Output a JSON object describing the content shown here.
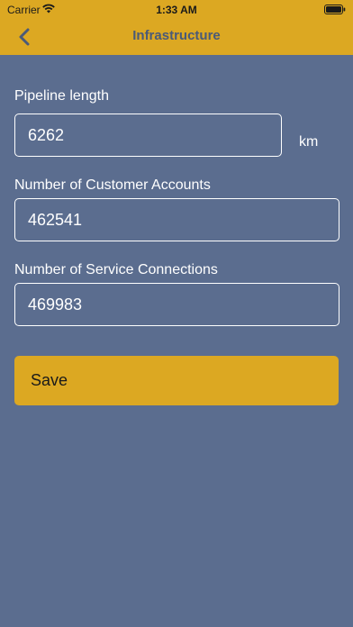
{
  "status_bar": {
    "carrier": "Carrier",
    "time": "1:33 AM",
    "icons": [
      "wifi-icon",
      "battery-icon"
    ]
  },
  "nav": {
    "title": "Infrastructure",
    "back_icon": "chevron-left-icon"
  },
  "form": {
    "pipeline_length": {
      "label": "Pipeline length",
      "value": "6262",
      "unit": "km"
    },
    "customer_accounts": {
      "label": "Number of Customer Accounts",
      "value": "462541"
    },
    "service_connections": {
      "label": "Number of Service Connections",
      "value": "469983"
    }
  },
  "save_button": {
    "label": "Save"
  },
  "colors": {
    "header": "#dca822",
    "background": "#5b6d8f",
    "title": "#4a5a78",
    "button": "#dca822"
  }
}
